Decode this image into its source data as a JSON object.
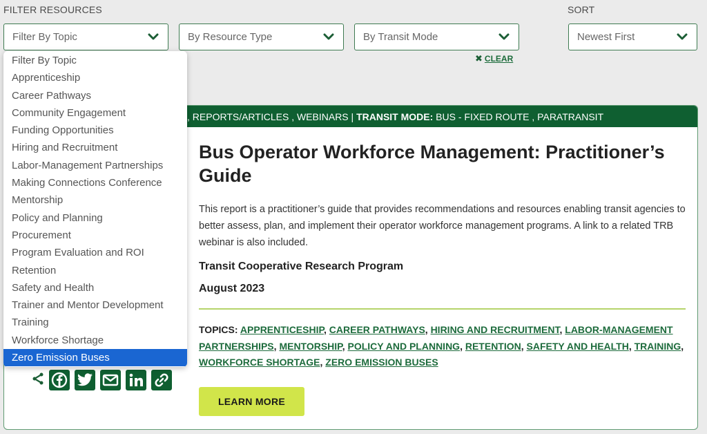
{
  "filters": {
    "section_label": "FILTER RESOURCES",
    "topic_select": "Filter By Topic",
    "resource_type_select": "By Resource Type",
    "transit_mode_select": "By Transit Mode",
    "clear_label": "CLEAR"
  },
  "sort": {
    "section_label": "SORT",
    "selected": "Newest First"
  },
  "topic_dropdown": {
    "options": [
      "Filter By Topic",
      "Apprenticeship",
      "Career Pathways",
      "Community Engagement",
      "Funding Opportunities",
      "Hiring and Recruitment",
      "Labor-Management Partnerships",
      "Making Connections Conference",
      "Mentorship",
      "Policy and Planning",
      "Procurement",
      "Program Evaluation and ROI",
      "Retention",
      "Safety and Health",
      "Trainer and Mentor Development",
      "Training",
      "Workforce Shortage",
      "Zero Emission Buses"
    ],
    "highlighted": "Zero Emission Buses"
  },
  "resource": {
    "header_prefix": ", REPORTS/ARTICLES , WEBINARS | ",
    "header_mode_label": "TRANSIT MODE:",
    "header_mode_values": " BUS - FIXED ROUTE , PARATRANSIT",
    "title": "Bus Operator Workforce Management: Practitioner’s Guide",
    "description": "This report is a practitioner’s guide that provides recommendations and resources enabling transit agencies to better assess, plan, and implement their operator workforce management programs. A link to a related TRB webinar is also included.",
    "organization": "Transit Cooperative Research Program",
    "date": "August 2023",
    "topics_label": "TOPICS:",
    "topics": [
      "APPRENTICESHIP",
      "CAREER PATHWAYS",
      "HIRING AND RECRUITMENT",
      "LABOR-MANAGEMENT PARTNERSHIPS",
      "MENTORSHIP",
      "POLICY AND PLANNING",
      "RETENTION",
      "SAFETY AND HEALTH",
      "TRAINING",
      "WORKFORCE SHORTAGE",
      "ZERO EMISSION BUSES"
    ],
    "learn_more": "LEARN MORE"
  },
  "share": {
    "icons": [
      "share-icon",
      "facebook-icon",
      "twitter-icon",
      "email-icon",
      "linkedin-icon",
      "link-icon"
    ]
  },
  "colors": {
    "brand_green": "#0f5f31",
    "accent_lime": "#d1e54a",
    "link_green": "#1d6b3c",
    "selected_blue": "#1a66d2"
  }
}
